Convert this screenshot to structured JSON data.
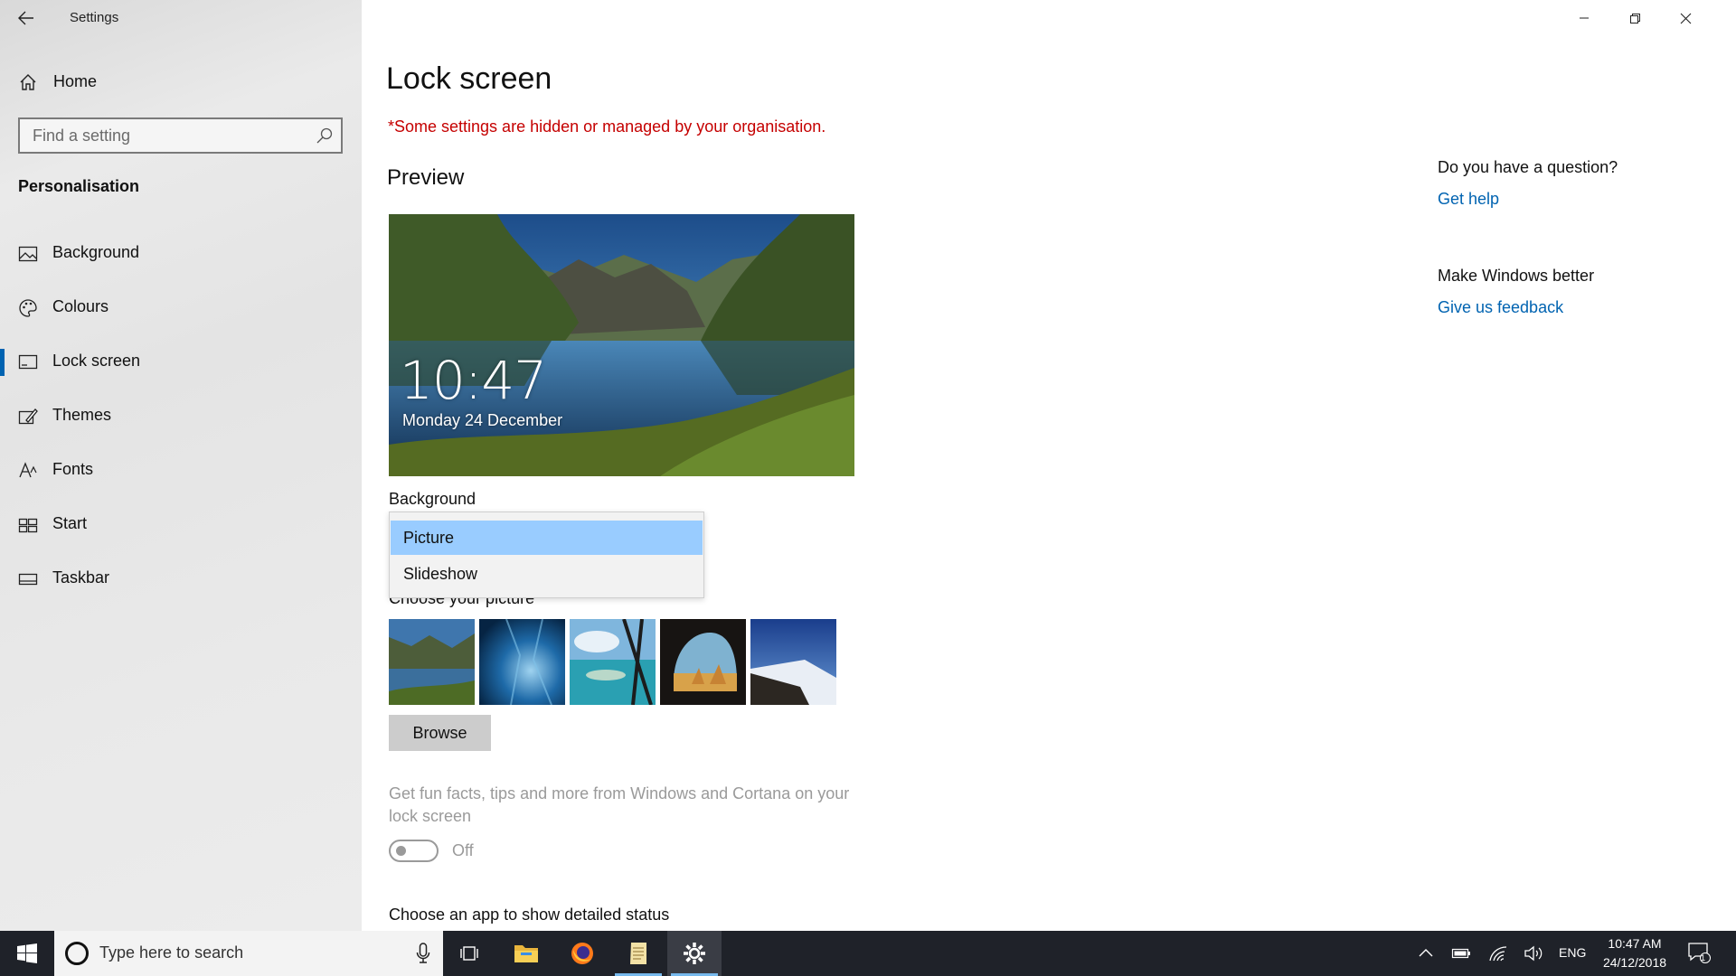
{
  "window": {
    "app_title": "Settings",
    "caption": {
      "minimize": "—",
      "restore": "❐",
      "close": "✕"
    }
  },
  "sidebar": {
    "home_label": "Home",
    "search_placeholder": "Find a setting",
    "section_title": "Personalisation",
    "items": [
      {
        "label": "Background",
        "icon": "picture-icon"
      },
      {
        "label": "Colours",
        "icon": "palette-icon"
      },
      {
        "label": "Lock screen",
        "icon": "lock-screen-icon",
        "active": true
      },
      {
        "label": "Themes",
        "icon": "brush-icon"
      },
      {
        "label": "Fonts",
        "icon": "font-icon"
      },
      {
        "label": "Start",
        "icon": "start-tiles-icon"
      },
      {
        "label": "Taskbar",
        "icon": "taskbar-icon"
      }
    ]
  },
  "main": {
    "title": "Lock screen",
    "managed_notice": "*Some settings are hidden or managed by your organisation.",
    "preview_heading": "Preview",
    "preview_time": "10:47",
    "preview_date": "Monday 24 December",
    "background_label": "Background",
    "background_options": [
      "Picture",
      "Slideshow"
    ],
    "background_selected": "Picture",
    "choose_picture_label": "Choose your picture",
    "browse_label": "Browse",
    "tips_text": "Get fun facts, tips and more from Windows and Cortana on your lock screen",
    "tips_toggle_state": "Off",
    "detailed_status_label": "Choose an app to show detailed status"
  },
  "right_panel": {
    "question": "Do you have a question?",
    "get_help": "Get help",
    "improve": "Make Windows better",
    "feedback": "Give us feedback"
  },
  "taskbar": {
    "search_placeholder": "Type here to search",
    "language": "ENG",
    "time": "10:47 AM",
    "date": "24/12/2018",
    "notification_count": "1"
  },
  "colors": {
    "accent": "#0063b1",
    "managed_notice": "#c50000",
    "dropdown_selected": "#99ccff",
    "taskbar": "#1f2229"
  }
}
